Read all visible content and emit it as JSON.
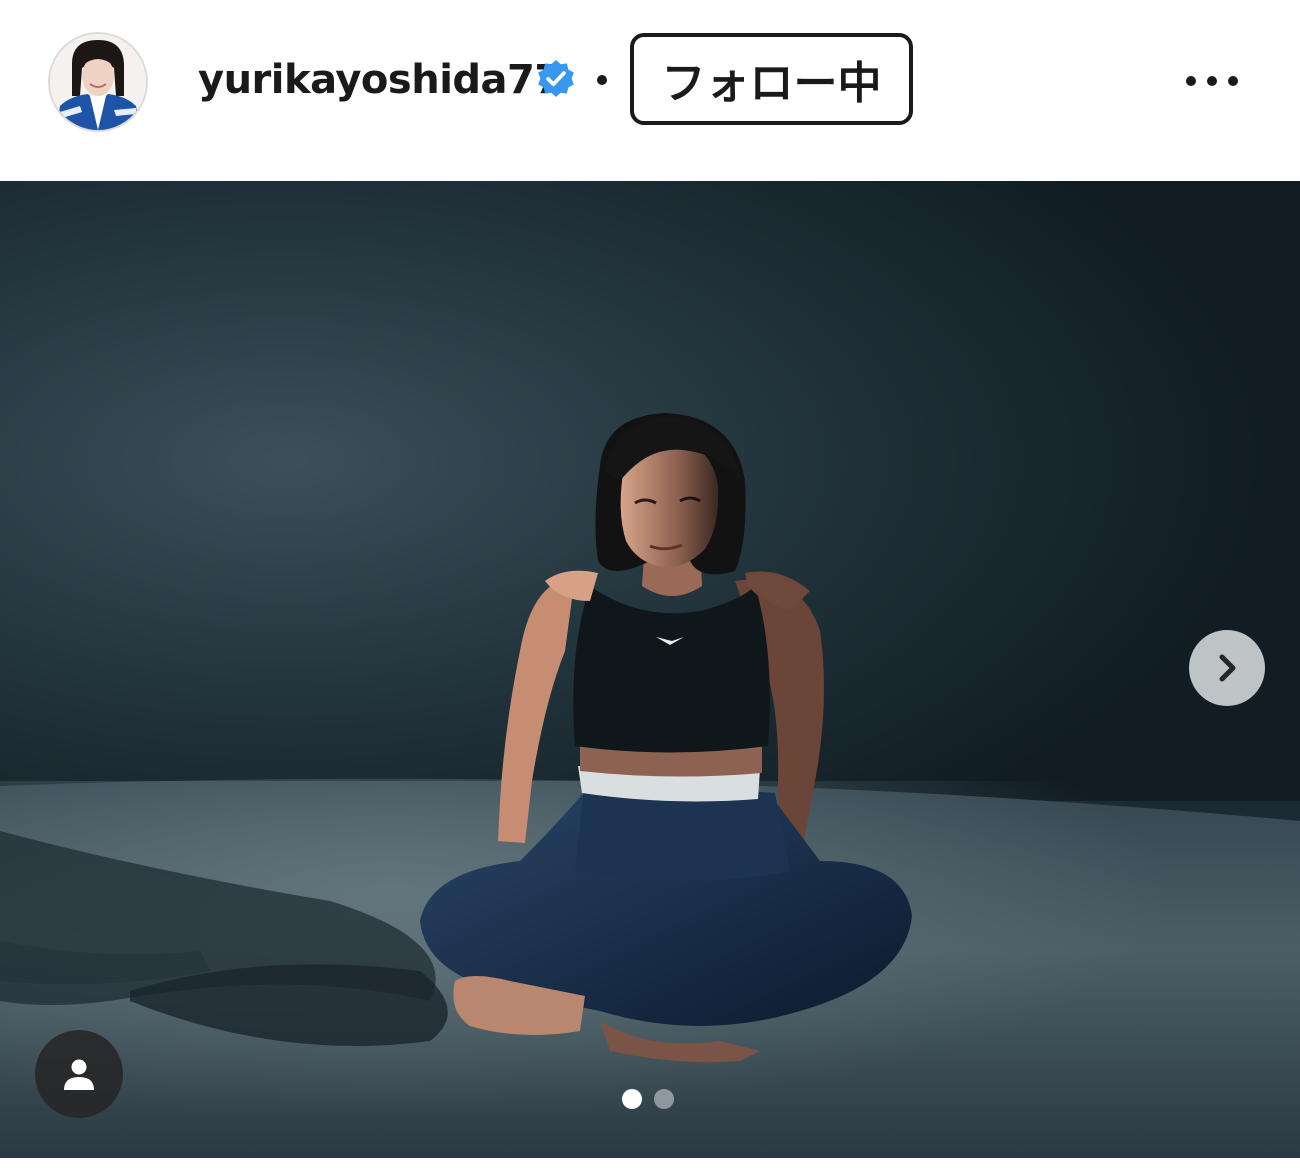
{
  "post_header": {
    "username": "yurikayoshida77",
    "verified": true,
    "follow_label": "フォロー中",
    "icons": {
      "avatar": "profile-photo",
      "verified": "verified-badge-icon",
      "more": "more-options-icon"
    },
    "colors": {
      "verified_badge": "#3897f0",
      "text": "#1a1a1a"
    }
  },
  "media": {
    "carousel": {
      "slide_count": 2,
      "active_index": 0
    },
    "icons": {
      "next": "chevron-right-icon",
      "tags": "person-icon"
    }
  }
}
